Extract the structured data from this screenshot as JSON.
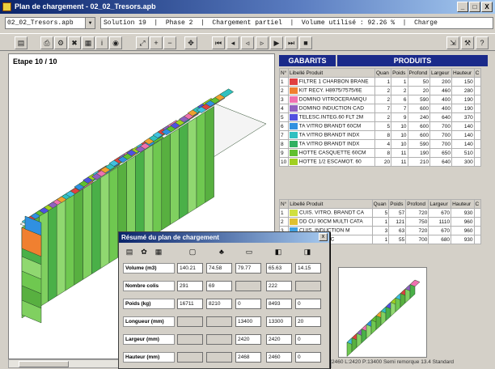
{
  "window": {
    "title": "Plan de chargement - 02_02_Tresors.apb",
    "controls": [
      "_",
      "□",
      "X"
    ]
  },
  "file_combo": "02_02_Tresors.apb",
  "status_line": "Solution 19  |  Phase 2  |  Chargement partiel  |  Volume utilisé : 92.26 %  |  Charge",
  "toolbar": {
    "icons": [
      "open-icon",
      "print-icon",
      "settings-icon",
      "delete-icon",
      "table-icon",
      "info-icon",
      "camera-icon",
      "zoom-fit-icon",
      "zoom-in-icon",
      "zoom-out-icon",
      "move-icon",
      "first-icon",
      "prev-icon",
      "play-prev-icon",
      "next-icon",
      "play-icon",
      "last-icon",
      "end-icon",
      "export-icon",
      "config-icon",
      "help-icon"
    ]
  },
  "view": {
    "step_label": "Etape 10 / 10"
  },
  "gabarits": {
    "header": "GABARITS"
  },
  "produits": {
    "header": "PRODUITS",
    "columns": [
      "N°",
      "Libellé Produit",
      "Quan",
      "Poids",
      "Profond",
      "Largeur",
      "Hauteur",
      "C"
    ],
    "rows": [
      {
        "n": "1",
        "label": "FILTRE 1 CHARBON BRANE",
        "q": "1",
        "p": "1",
        "prof": "50",
        "larg": "200",
        "haut": "150",
        "color": "#e04040"
      },
      {
        "n": "2",
        "label": "KIT RECY. H8975/7575/6E",
        "q": "2",
        "p": "2",
        "prof": "20",
        "larg": "460",
        "haut": "280",
        "color": "#f08030"
      },
      {
        "n": "3",
        "label": "DOMINO VITROCERAMIQU",
        "q": "2",
        "p": "6",
        "prof": "590",
        "larg": "400",
        "haut": "190",
        "color": "#f070b0"
      },
      {
        "n": "4",
        "label": "DOMINO INDUCTION CAD",
        "q": "7",
        "p": "7",
        "prof": "600",
        "larg": "400",
        "haut": "190",
        "color": "#9060c0"
      },
      {
        "n": "5",
        "label": "TELESC.INTEG.60 FLT 2M",
        "q": "2",
        "p": "9",
        "prof": "240",
        "larg": "640",
        "haut": "370",
        "color": "#5050e0"
      },
      {
        "n": "6",
        "label": "TA VITRO BRANDT 60CM",
        "q": "5",
        "p": "10",
        "prof": "600",
        "larg": "700",
        "haut": "140",
        "color": "#3090e0"
      },
      {
        "n": "7",
        "label": "TA VITRO BRANDT INDX",
        "q": "8",
        "p": "10",
        "prof": "600",
        "larg": "700",
        "haut": "140",
        "color": "#30c0c0"
      },
      {
        "n": "8",
        "label": "TA VITRO BRANDT INDX",
        "q": "4",
        "p": "10",
        "prof": "590",
        "larg": "700",
        "haut": "140",
        "color": "#30b060"
      },
      {
        "n": "9",
        "label": "HOTTE CASQUETTE 60CM",
        "q": "8",
        "p": "11",
        "prof": "190",
        "larg": "650",
        "haut": "510",
        "color": "#60c030"
      },
      {
        "n": "10",
        "label": "HOTTE 1/2 ESCAMOT. 60",
        "q": "20",
        "p": "11",
        "prof": "210",
        "larg": "640",
        "haut": "300",
        "color": "#a0d020"
      }
    ]
  },
  "produits2": {
    "columns": [
      "N°",
      "Libellé Produit",
      "Quan",
      "Poids",
      "Profond",
      "Largeur",
      "Hauteur",
      "C"
    ],
    "rows": [
      {
        "n": "1",
        "label": "CUIS. VITRO. BRANDT CA",
        "q": "5",
        "p": "57",
        "prof": "720",
        "larg": "670",
        "haut": "930",
        "color": "#d0e040"
      },
      {
        "n": "2",
        "label": "DD CU 90CM MULTI CATA",
        "q": "1",
        "p": "121",
        "prof": "750",
        "larg": "1110",
        "haut": "960",
        "color": "#e0c030"
      },
      {
        "n": "3",
        "label": "CUIS. INDUCTION M",
        "q": "3",
        "p": "63",
        "prof": "720",
        "larg": "670",
        "haut": "960",
        "color": "#40a0e0"
      },
      {
        "n": "4",
        "label": "VITRO BLANC",
        "q": "1",
        "p": "55",
        "prof": "700",
        "larg": "680",
        "haut": "930",
        "color": "#60c060"
      }
    ]
  },
  "dialog": {
    "title": "Résumé du plan de chargement",
    "labels": [
      "Volume (m3)",
      "Nombre colis",
      "Poids (kg)",
      "Longueur (mm)",
      "Largeur (mm)",
      "Hauteur (mm)"
    ],
    "values": [
      [
        "140.21",
        "74.58",
        "79.77",
        "65.63",
        "14.15"
      ],
      [
        "291",
        "69",
        "",
        "222",
        ""
      ],
      [
        "16711",
        "8210",
        "0",
        "8493",
        "0"
      ],
      [
        "",
        "",
        "13400",
        "13300",
        "20"
      ],
      [
        "",
        "",
        "2420",
        "2420",
        "0"
      ],
      [
        "",
        "",
        "2468",
        "2460",
        "0"
      ]
    ]
  },
  "statusbar": "2460   L:2420   P:13400   Semi remorque 13.4 Standard"
}
